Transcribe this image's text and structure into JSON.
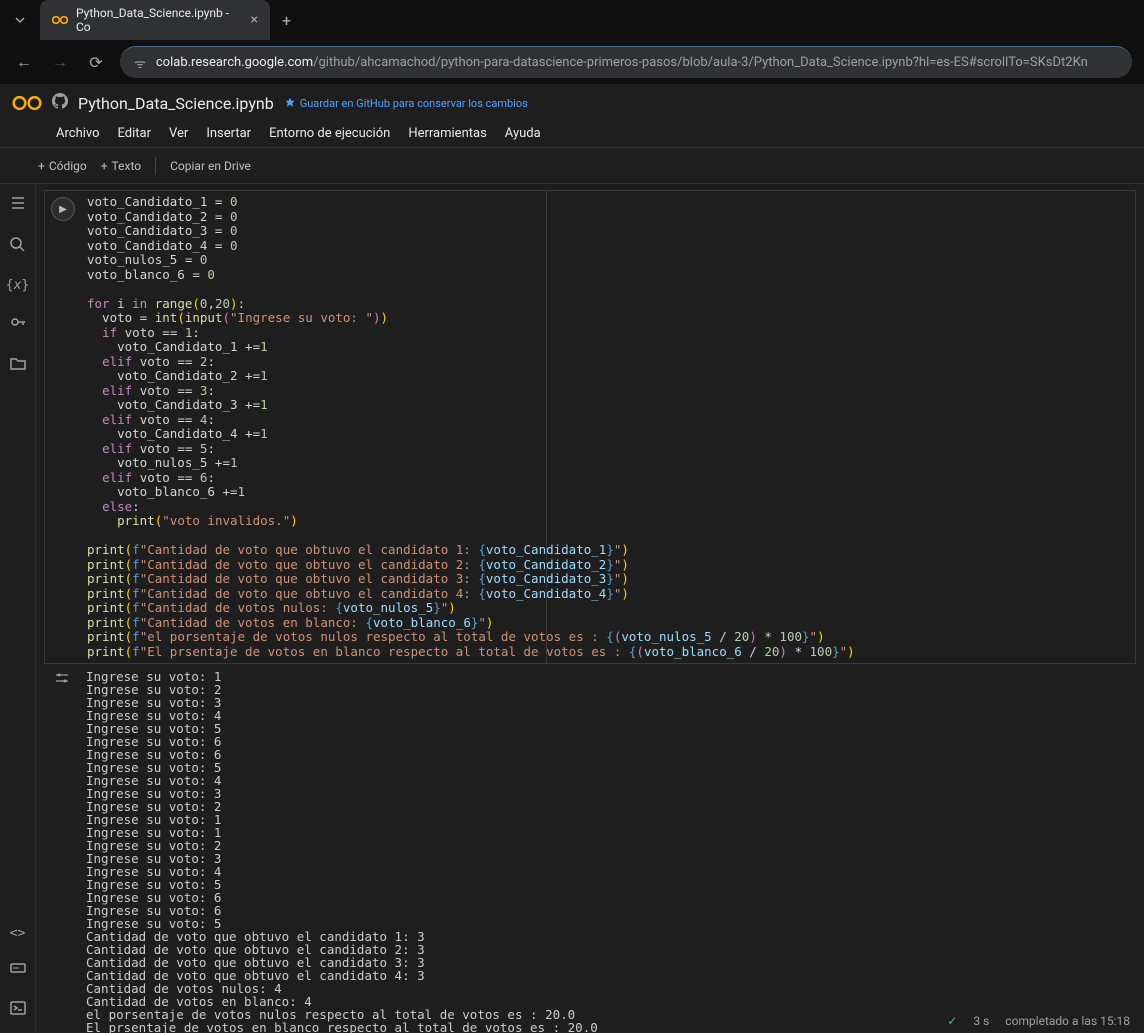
{
  "browser": {
    "tab_title": "Python_Data_Science.ipynb - Co",
    "url_host": "colab.research.google.com",
    "url_path": "/github/ahcamachod/python-para-datascience-primeros-pasos/blob/aula-3/Python_Data_Science.ipynb?hl=es-ES#scrollTo=SKsDt2Kn"
  },
  "header": {
    "notebook_title": "Python_Data_Science.ipynb",
    "save_github": "Guardar en GitHub para conservar los cambios"
  },
  "menus": {
    "archivo": "Archivo",
    "editar": "Editar",
    "ver": "Ver",
    "insertar": "Insertar",
    "entorno": "Entorno de ejecución",
    "herramientas": "Herramientas",
    "ayuda": "Ayuda"
  },
  "toolbar": {
    "codigo": "Código",
    "texto": "Texto",
    "copiar": "Copiar en Drive"
  },
  "code": {
    "l1": "voto_Candidato_1 = ",
    "l1n": "0",
    "l2": "voto_Candidato_2 = ",
    "l2n": "0",
    "l3": "voto_Candidato_3 = ",
    "l3n": "0",
    "l4": "voto_Candidato_4 = ",
    "l4n": "0",
    "l5": "voto_nulos_5 = ",
    "l5n": "0",
    "l6": "voto_blanco_6 = ",
    "l6n": "0",
    "for": "for",
    "in": "in",
    "range": "range",
    "rargs1": "0",
    "rargs2": "20",
    "voto_eq": "  voto = ",
    "int": "int",
    "input": "input",
    "prompt": "\"Ingrese su voto: \"",
    "if": "if",
    "elif": "elif",
    "else": "else",
    "voto": "voto",
    "eq": " == ",
    "n1": "1",
    "n2": "2",
    "n3": "3",
    "n4": "4",
    "n5": "5",
    "n6": "6",
    "inc1": "    voto_Candidato_1 +=",
    "inc2": "    voto_Candidato_2 +=",
    "inc3": "    voto_Candidato_3 +=",
    "inc4": "    voto_Candidato_4 +=",
    "inc5": "    voto_nulos_5 +=",
    "inc6": "    voto_blanco_6 +=",
    "one": "1",
    "print": "print",
    "invalid": "\"voto invalidos.\"",
    "p1a": "\"Cantidad de voto que obtuvo el candidato 1: ",
    "p1v": "voto_Candidato_1",
    "p2a": "\"Cantidad de voto que obtuvo el candidato 2: ",
    "p2v": "voto_Candidato_2",
    "p3a": "\"Cantidad de voto que obtuvo el candidato 3: ",
    "p3v": "voto_Candidato_3",
    "p4a": "\"Cantidad de voto que obtuvo el candidato 4: ",
    "p4v": "voto_Candidato_4",
    "p5a": "\"Cantidad de votos nulos: ",
    "p5v": "voto_nulos_5",
    "p6a": "\"Cantidad de votos en blanco: ",
    "p6v": "voto_blanco_6",
    "p7a": "\"el porsentaje de votos nulos respecto al total de votos es : ",
    "p7v": "voto_nulos_5",
    "p8a": "\"El prsentaje de votos en blanco respecto al total de votos es : ",
    "p8v": "voto_blanco_6",
    "div": " / ",
    "twenty": "20",
    "mul": " * ",
    "hundred": "100"
  },
  "output": "Ingrese su voto: 1\nIngrese su voto: 2\nIngrese su voto: 3\nIngrese su voto: 4\nIngrese su voto: 5\nIngrese su voto: 6\nIngrese su voto: 6\nIngrese su voto: 5\nIngrese su voto: 4\nIngrese su voto: 3\nIngrese su voto: 2\nIngrese su voto: 1\nIngrese su voto: 1\nIngrese su voto: 2\nIngrese su voto: 3\nIngrese su voto: 4\nIngrese su voto: 5\nIngrese su voto: 6\nIngrese su voto: 6\nIngrese su voto: 5\nCantidad de voto que obtuvo el candidato 1: 3\nCantidad de voto que obtuvo el candidato 2: 3\nCantidad de voto que obtuvo el candidato 3: 3\nCantidad de voto que obtuvo el candidato 4: 3\nCantidad de votos nulos: 4\nCantidad de votos en blanco: 4\nel porsentaje de votos nulos respecto al total de votos es : 20.0\nEl prsentaje de votos en blanco respecto al total de votos es : 20.0",
  "footer": {
    "time": "3 s",
    "completed": "completado a las 15:18"
  }
}
